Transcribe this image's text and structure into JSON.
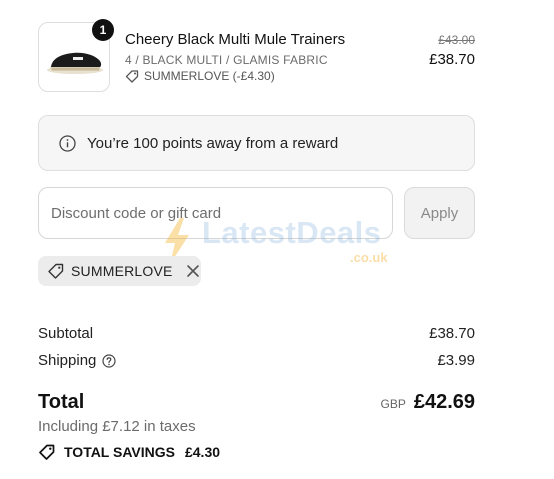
{
  "product": {
    "quantity": "1",
    "name": "Cheery Black Multi Mule Trainers",
    "variant": "4 / BLACK MULTI / GLAMIS FABRIC",
    "discount_applied": "SUMMERLOVE (-£4.30)",
    "original_price": "£43.00",
    "price": "£38.70"
  },
  "reward": {
    "text": "You’re 100 points away from a reward",
    "icon": "info-icon"
  },
  "discount": {
    "placeholder": "Discount code or gift card",
    "value": "",
    "apply_label": "Apply"
  },
  "watermark": {
    "text": "LatestDeals",
    "sub": ".co.uk"
  },
  "applied_code": {
    "label": "SUMMERLOVE",
    "icon": "tag-icon"
  },
  "summary": {
    "subtotal_label": "Subtotal",
    "subtotal_value": "£38.70",
    "shipping_label": "Shipping",
    "shipping_value": "£3.99",
    "total_label": "Total",
    "currency": "GBP",
    "total_value": "£42.69",
    "taxes_text": "Including £7.12 in taxes",
    "savings_label": "TOTAL SAVINGS",
    "savings_value": "£4.30"
  }
}
